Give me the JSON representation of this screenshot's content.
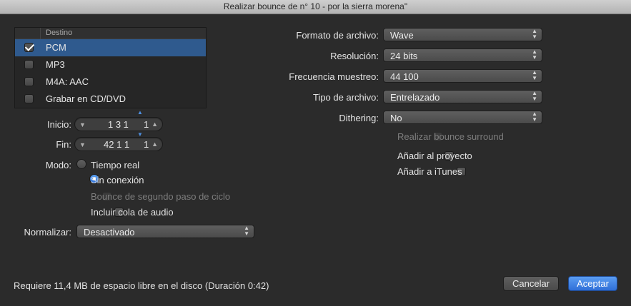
{
  "window": {
    "title": "Realizar bounce de n° 10 - por la sierra morena\""
  },
  "destination": {
    "header": "Destino",
    "items": [
      {
        "label": "PCM",
        "checked": true,
        "selected": true
      },
      {
        "label": "MP3",
        "checked": false,
        "selected": false
      },
      {
        "label": "M4A: AAC",
        "checked": false,
        "selected": false
      },
      {
        "label": "Grabar en CD/DVD",
        "checked": false,
        "selected": false
      }
    ]
  },
  "start": {
    "label": "Inicio:",
    "value": "1  3  1",
    "subvalue": "1"
  },
  "end": {
    "label": "Fin:",
    "value": "42  1  1",
    "subvalue": "1"
  },
  "mode": {
    "label": "Modo:",
    "options": [
      {
        "label": "Tiempo real",
        "selected": false
      },
      {
        "label": "Sin conexión",
        "selected": true
      }
    ]
  },
  "options_left": {
    "cycle_bounce": {
      "label": "Bounce de segundo paso de ciclo",
      "enabled": false,
      "checked": false
    },
    "audio_tail": {
      "label": "Incluir cola de audio",
      "enabled": true,
      "checked": false
    }
  },
  "normalize": {
    "label": "Normalizar:",
    "value": "Desactivado"
  },
  "right": {
    "file_format": {
      "label": "Formato de archivo:",
      "value": "Wave"
    },
    "resolution": {
      "label": "Resolución:",
      "value": "24 bits"
    },
    "sample_rate": {
      "label": "Frecuencia muestreo:",
      "value": "44 100"
    },
    "file_type": {
      "label": "Tipo de archivo:",
      "value": "Entrelazado"
    },
    "dithering": {
      "label": "Dithering:",
      "value": "No"
    },
    "surround": {
      "label": "Realizar bounce surround",
      "enabled": false
    },
    "add_project": {
      "label": "Añadir al proyecto",
      "checked": false
    },
    "add_itunes": {
      "label": "Añadir a iTunes",
      "checked": false
    }
  },
  "footer": {
    "status": "Requiere 11,4 MB de espacio libre en el disco (Duración 0:42)",
    "cancel": "Cancelar",
    "accept": "Aceptar"
  },
  "colors": {
    "accent": "#2f6fd8",
    "selection": "#2f5a8e",
    "background": "#2b2b2b"
  }
}
